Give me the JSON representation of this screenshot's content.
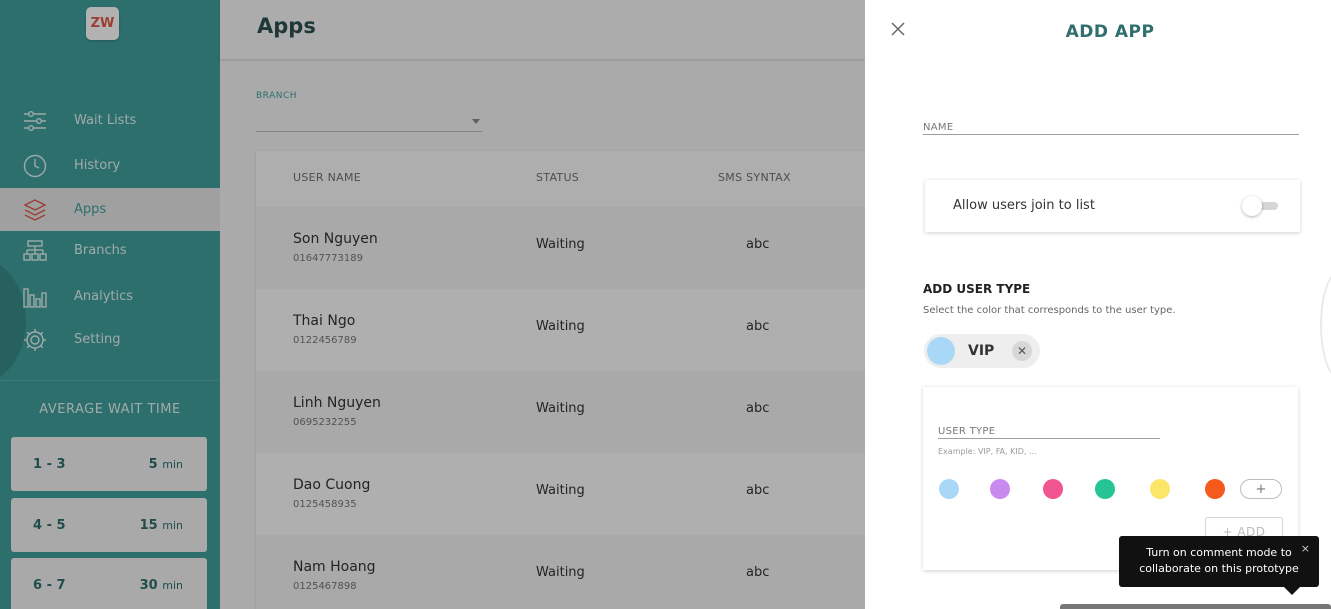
{
  "logo": {
    "text": "ZW"
  },
  "sidebar": {
    "items": [
      {
        "label": "Wait Lists",
        "icon": "sliders-icon"
      },
      {
        "label": "History",
        "icon": "clock-icon"
      },
      {
        "label": "Apps",
        "icon": "layers-icon"
      },
      {
        "label": "Branchs",
        "icon": "branch-tree-icon"
      },
      {
        "label": "Analytics",
        "icon": "bar-chart-icon"
      },
      {
        "label": "Setting",
        "icon": "gear-icon"
      }
    ],
    "active_index": 2,
    "avg_wait_title": "AVERAGE WAIT TIME",
    "wait_times": [
      {
        "range": "1 - 3",
        "minutes": "5",
        "unit": "min"
      },
      {
        "range": "4 - 5",
        "minutes": "15",
        "unit": "min"
      },
      {
        "range": "6 - 7",
        "minutes": "30",
        "unit": "min"
      }
    ]
  },
  "main": {
    "title": "Apps",
    "branch_label": "BRANCH",
    "branch_value": "",
    "table": {
      "headers": [
        "USER NAME",
        "STATUS",
        "SMS SYNTAX"
      ],
      "rows": [
        {
          "name": "Son Nguyen",
          "phone": "01647773189",
          "status": "Waiting",
          "sms": "abc"
        },
        {
          "name": "Thai Ngo",
          "phone": "0122456789",
          "status": "Waiting",
          "sms": "abc"
        },
        {
          "name": "Linh Nguyen",
          "phone": "0695232255",
          "status": "Waiting",
          "sms": "abc"
        },
        {
          "name": "Dao Cuong",
          "phone": "0125458935",
          "status": "Waiting",
          "sms": "abc"
        },
        {
          "name": "Nam Hoang",
          "phone": "0125467898",
          "status": "Waiting",
          "sms": "abc"
        }
      ]
    }
  },
  "panel": {
    "title": "ADD APP",
    "name_placeholder": "NAME",
    "allow_users_label": "Allow users join to list",
    "allow_users_enabled": false,
    "add_user_type_title": "ADD USER TYPE",
    "add_user_type_subtitle": "Select the color that corresponds to the user type.",
    "chips": [
      {
        "label": "VIP",
        "color": "#a9d8f7",
        "remove": "✕"
      }
    ],
    "user_type_placeholder": "USER TYPE",
    "user_type_hint": "Example: VIP, FA, KID, ...",
    "colors": [
      "#a9d8f7",
      "#c98af0",
      "#f0558f",
      "#26c495",
      "#fbe66a",
      "#f55a1c"
    ],
    "plus_label": "+",
    "add_button_label": "+ ADD"
  },
  "tooltip": {
    "text_line1": "Turn on comment mode to",
    "text_line2": "collaborate on this prototype",
    "close": "×"
  },
  "colors": {
    "sidebar": "#3f9f9c",
    "accent": "#2f6f6d"
  }
}
